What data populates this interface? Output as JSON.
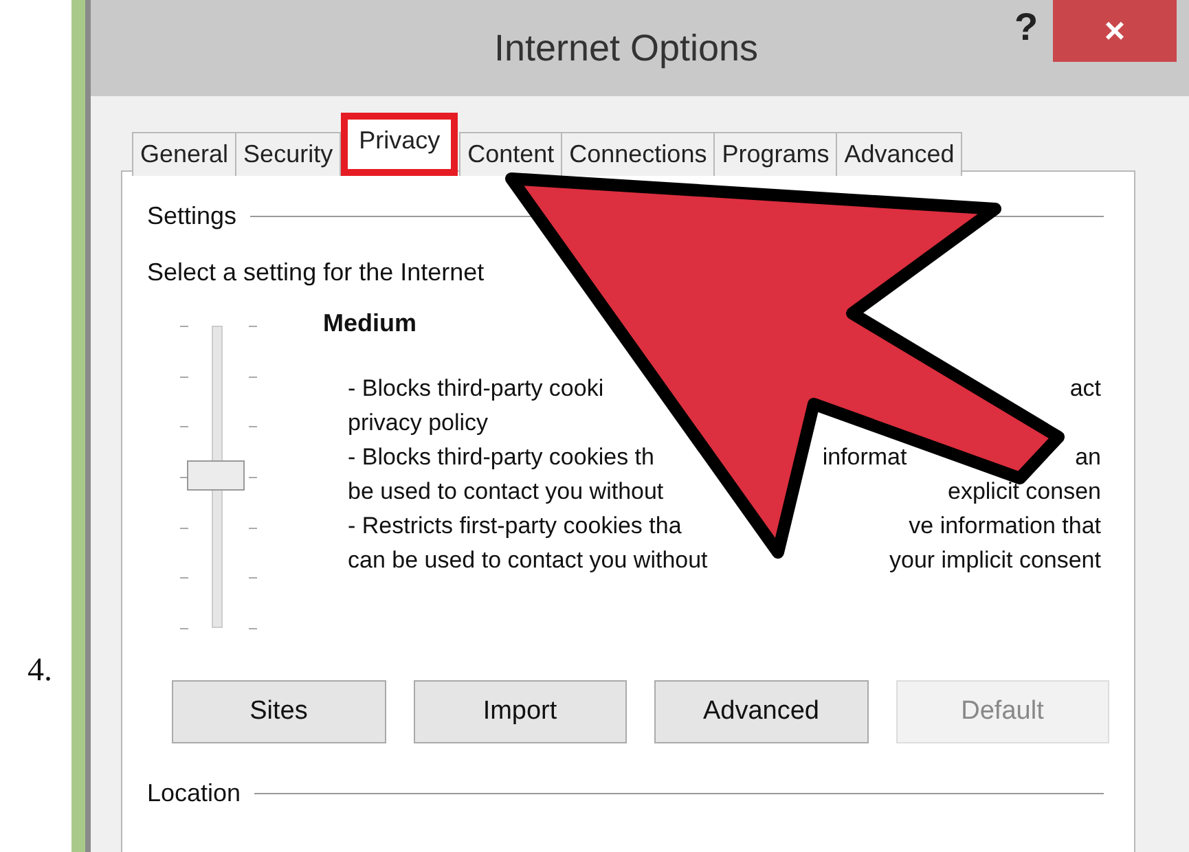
{
  "step_number": "4.",
  "window": {
    "title": "Internet Options",
    "help": "?",
    "close": "×"
  },
  "tabs": [
    {
      "label": "General",
      "selected": false
    },
    {
      "label": "Security",
      "selected": false
    },
    {
      "label": "Privacy",
      "selected": true
    },
    {
      "label": "Content",
      "selected": false
    },
    {
      "label": "Connections",
      "selected": false
    },
    {
      "label": "Programs",
      "selected": false
    },
    {
      "label": "Advanced",
      "selected": false
    }
  ],
  "settings": {
    "heading": "Settings",
    "instruction": "Select a setting for the Internet",
    "slider": {
      "level": 0.5
    },
    "level_name": "Medium",
    "description_lines": [
      [
        "- Blocks third-party cooki",
        "act"
      ],
      [
        "privacy policy"
      ],
      [
        "- Blocks third-party cookies th",
        "informat",
        "an"
      ],
      [
        "be used to contact you without",
        "explicit consen"
      ],
      [
        "- Restricts first-party cookies tha",
        "ve information that"
      ],
      [
        "can be used to contact you without",
        "your implicit consent"
      ]
    ]
  },
  "buttons": [
    {
      "label": "Sites",
      "disabled": false
    },
    {
      "label": "Import",
      "disabled": false
    },
    {
      "label": "Advanced",
      "disabled": false
    },
    {
      "label": "Default",
      "disabled": true
    }
  ],
  "location": {
    "heading": "Location"
  }
}
